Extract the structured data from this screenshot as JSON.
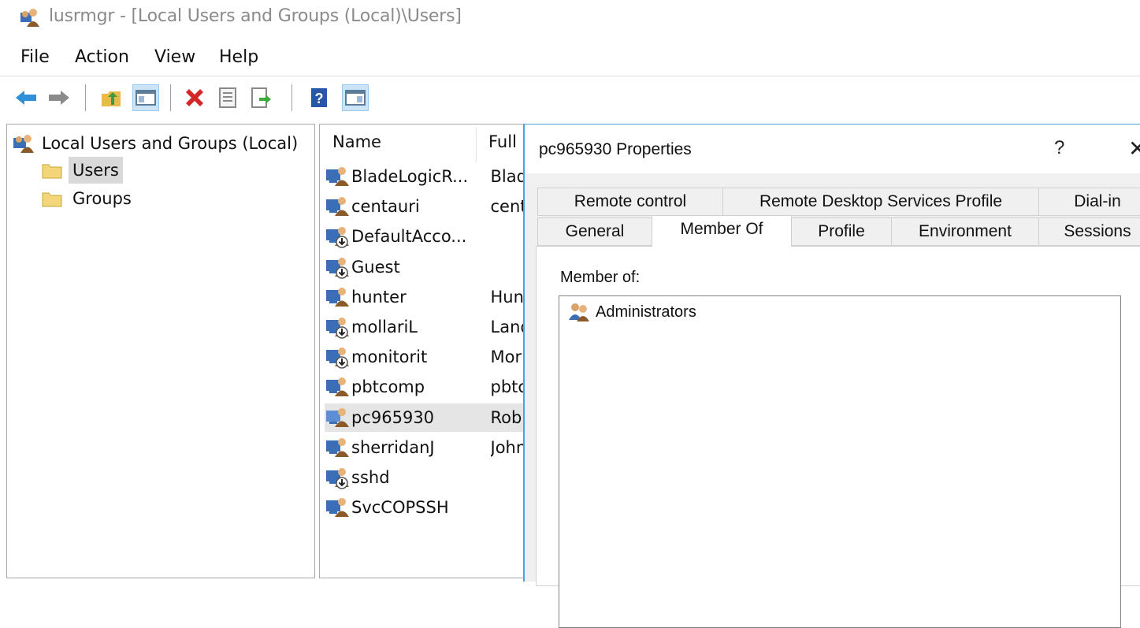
{
  "window": {
    "title": "lusrmgr - [Local Users and Groups (Local)\\Users]",
    "icon": "users-mmc-icon"
  },
  "menu": [
    "File",
    "Action",
    "View",
    "Help"
  ],
  "toolbar": {
    "buttons": [
      "back-arrow-icon",
      "forward-arrow-icon",
      "up-folder-icon",
      "show-hide-tree-icon",
      "delete-icon",
      "properties-icon",
      "export-list-icon",
      "help-icon",
      "show-hide-action-pane-icon"
    ],
    "active": [
      "show-hide-tree-icon",
      "show-hide-action-pane-icon"
    ]
  },
  "tree": {
    "root": "Local Users and Groups (Local)",
    "items": [
      {
        "label": "Users",
        "selected": true
      },
      {
        "label": "Groups",
        "selected": false
      }
    ]
  },
  "list": {
    "columns": [
      "Name",
      "Full"
    ],
    "rows": [
      {
        "name": "BladeLogicR...",
        "full": "Blad",
        "disabled": false
      },
      {
        "name": "centauri",
        "full": "cent",
        "disabled": false
      },
      {
        "name": "DefaultAcco...",
        "full": "",
        "disabled": true
      },
      {
        "name": "Guest",
        "full": "",
        "disabled": true
      },
      {
        "name": "hunter",
        "full": "Hun",
        "disabled": false
      },
      {
        "name": "mollariL",
        "full": "Land",
        "disabled": true
      },
      {
        "name": "monitorit",
        "full": "Mor",
        "disabled": true
      },
      {
        "name": "pbtcomp",
        "full": "pbtc",
        "disabled": false
      },
      {
        "name": "pc965930",
        "full": "Rob",
        "disabled": false,
        "selected": true
      },
      {
        "name": "sherridanJ",
        "full": "John",
        "disabled": false
      },
      {
        "name": "sshd",
        "full": "",
        "disabled": true
      },
      {
        "name": "SvcCOPSSH",
        "full": "",
        "disabled": false
      }
    ]
  },
  "dialog": {
    "title": "pc965930 Properties",
    "help": "?",
    "close": "✕",
    "tabs_row1": [
      "Remote control",
      "Remote Desktop Services Profile",
      "Dial-in"
    ],
    "tabs_row2": [
      "General",
      "Member Of",
      "Profile",
      "Environment",
      "Sessions"
    ],
    "selected_tab": "Member Of",
    "member_of_label": "Member of:",
    "members": [
      "Administrators"
    ]
  },
  "colors": {
    "accent_border": "#4aa3df",
    "selection_gray": "#d9d9d9",
    "toolbar_active": "#cce4f7"
  }
}
